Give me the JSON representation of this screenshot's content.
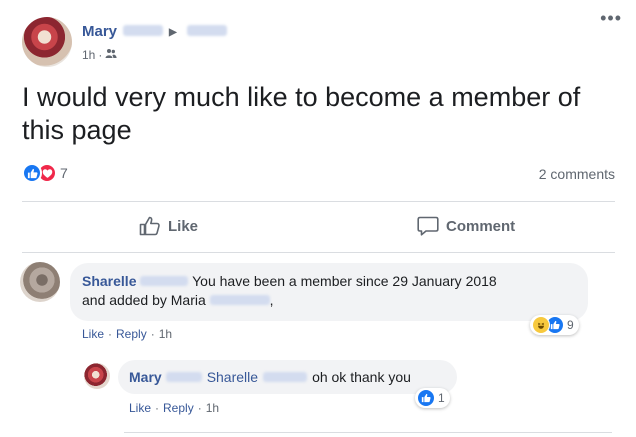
{
  "post": {
    "author": "Mary",
    "timestamp": "1h",
    "audience_icon": "friends-icon",
    "text": "I would very much like to become a member of this page",
    "menu_glyph": "•••"
  },
  "reactions": {
    "icons": [
      "like-reaction-icon",
      "love-reaction-icon"
    ],
    "count": "7",
    "comments_count": "2 comments"
  },
  "actions": {
    "like_label": "Like",
    "comment_label": "Comment"
  },
  "comments": [
    {
      "author": "Sharelle",
      "text_1": "You have been a member since 29 January 2018",
      "text_2": "and added by Maria",
      "text_3": ",",
      "reactions_icons": [
        "haha-reaction-icon",
        "like-reaction-icon"
      ],
      "reaction_count": "9",
      "like_label": "Like",
      "reply_label": "Reply",
      "separator": "·",
      "time": "1h"
    },
    {
      "author": "Mary",
      "mention": "Sharelle",
      "text": "oh ok thank you",
      "reactions_icons": [
        "like-reaction-icon"
      ],
      "reaction_count": "1",
      "like_label": "Like",
      "reply_label": "Reply",
      "separator": "·",
      "time": "1h"
    }
  ],
  "colors": {
    "link": "#385898",
    "muted": "#606770",
    "bubble": "#f2f3f5",
    "like_blue": "#1877f2",
    "love_red": "#f0284a"
  }
}
